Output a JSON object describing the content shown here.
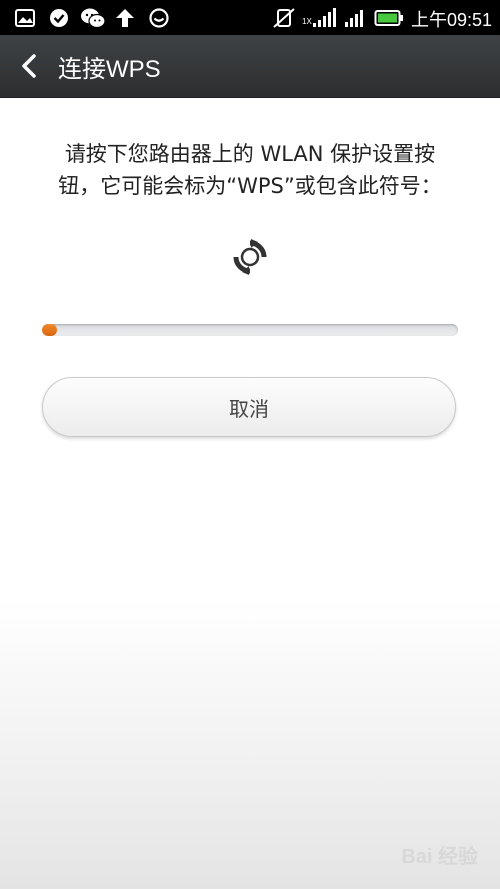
{
  "status_bar": {
    "time": "上午09:51",
    "signal_label": "1X",
    "icons": [
      "image-icon",
      "check-icon",
      "wechat-icon",
      "upload-arrow-icon",
      "sync-circle-icon",
      "vibrate-muted-icon",
      "signal-icon",
      "signal-bars-icon",
      "battery-charging-icon"
    ]
  },
  "title_bar": {
    "title": "连接WPS",
    "back_icon": "chevron-left-icon"
  },
  "main": {
    "message_line1": "请按下您路由器上的 WLAN 保护设置按",
    "message_line2": "钮，它可能会标为“WPS”或包含此符号：",
    "wps_symbol_icon": "wps-refresh-icon",
    "progress": 0.035,
    "cancel_label": "取消"
  },
  "watermark": {
    "text": "Bai 经验"
  },
  "colors": {
    "title_bar": "#35383a",
    "progress_fill": "#e8761d",
    "background": "#ffffff"
  }
}
